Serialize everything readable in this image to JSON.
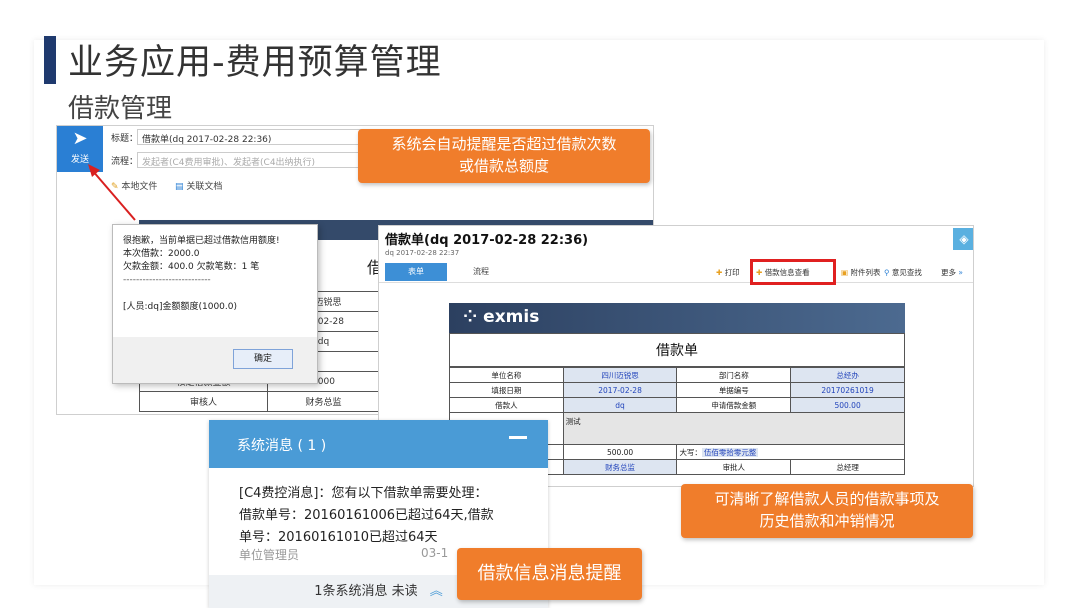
{
  "header": {
    "title": "业务应用-费用预算管理",
    "subtitle": "借款管理"
  },
  "compose": {
    "send_label": "发送",
    "subject_label": "标题：",
    "subject_value": "借款单(dq 2017-02-28 22:36)",
    "flow_label": "流程：",
    "flow_value": "发起者(C4费用审批)、发起者(C4出纳执行)",
    "local_file": "本地文件",
    "related_doc": "关联文档"
  },
  "dialog": {
    "line1": "很抱歉，当前单据已超过借款信用额度!",
    "line2": "本次借款：2000.0",
    "line3": "欠款金额：400.0 欠款笔数：1 笔",
    "divider": "---------------------------",
    "line4": "[人员:dq]金额额度(1000.0)",
    "ok": "确定"
  },
  "doc1": {
    "title_char": "借",
    "rows": [
      [
        "",
        "川迈锐思"
      ],
      [
        "",
        "17-02-28"
      ],
      [
        "",
        "dq"
      ],
      [
        "",
        ""
      ],
      [
        "核定借款金额",
        "2000"
      ],
      [
        "审核人",
        "财务总监"
      ]
    ]
  },
  "form": {
    "title": "借款单(dq 2017-02-28 22:36)",
    "sub": "dq   2017-02-28 22:37",
    "tab_form": "表单",
    "tab_flow": "流程",
    "print": "打印",
    "loan_info": "借款信息查看",
    "attachments": "附件列表",
    "opinion": "意见查找",
    "more": "更多",
    "logo": "exmis",
    "sheet_title": "借款单",
    "row1": [
      "单位名称",
      "四川迈锐思",
      "部门名称",
      "总经办"
    ],
    "row2": [
      "填报日期",
      "2017-02-28",
      "单据编号",
      "20170261019"
    ],
    "row3": [
      "借款人",
      "dq",
      "申请借款金额",
      "500.00"
    ],
    "row4_note": "测试",
    "row5_amount": "500.00",
    "row5_caps_label": "大写：",
    "row5_caps": "伍佰零拾零元整",
    "row6": [
      "财务总监",
      "审批人",
      "总经理"
    ]
  },
  "message": {
    "header": "系统消息 ( 1 )",
    "line1": "[C4费控消息]：您有以下借款单需要处理：",
    "line2": "借款单号：20160161006已超过64天,借款",
    "line3": "单号：20160161010已超过64天",
    "sender": "单位管理员",
    "date": "03-1",
    "footer": "1条系统消息 未读"
  },
  "callouts": {
    "auto_remind": "系统会自动提醒是否超过借款次数\n或借款总额度",
    "clear_view": "可清晰了解借款人员的借款事项及\n历史借款和冲销情况",
    "msg_remind": "借款信息消息提醒"
  },
  "colors": {
    "accent": "#f07d2b",
    "blue": "#4a9bd6",
    "title_bar": "#1f3a6e"
  }
}
